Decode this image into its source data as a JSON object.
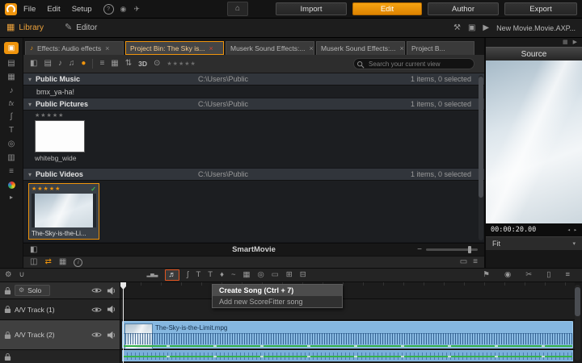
{
  "topbar": {
    "menus": [
      {
        "label": "File"
      },
      {
        "label": "Edit"
      },
      {
        "label": "Setup"
      }
    ],
    "mode_buttons": [
      {
        "label": "Import"
      },
      {
        "label": "Edit"
      },
      {
        "label": "Author"
      },
      {
        "label": "Export"
      }
    ]
  },
  "workspace": {
    "tabs": [
      {
        "label": "Library"
      },
      {
        "label": "Editor"
      }
    ],
    "project_title": "New Movie.Movie.AXP..."
  },
  "bin_tabs": [
    {
      "label": "Effects: Audio effects"
    },
    {
      "label": "Project Bin: The Sky is..."
    },
    {
      "label": "Muserk Sound Effects:..."
    },
    {
      "label": "Muserk Sound Effects:..."
    },
    {
      "label": "Project B..."
    }
  ],
  "lib_toolbar": {
    "threed_label": "3D",
    "stars": "★★★★★",
    "search_placeholder": "Search your current view"
  },
  "library": {
    "groups": [
      {
        "name": "Public Music",
        "path": "C:\\Users\\Public",
        "count": "1 items, 0 selected"
      },
      {
        "name": "Public Pictures",
        "path": "C:\\Users\\Public",
        "count": "1 items, 0 selected"
      },
      {
        "name": "Public Videos",
        "path": "C:\\Users\\Public",
        "count": "1 items, 0 selected"
      }
    ],
    "music_item": "bmx_ya-ha!",
    "picture_item": {
      "label": "whitebg_wide",
      "stars": "★★★★★"
    },
    "video_item": {
      "label": "The-Sky-is-the-Li...",
      "stars": "★★★★★",
      "check": "✓"
    },
    "smartmovie_label": "SmartMovie"
  },
  "tooltip": {
    "title": "Create Song (Ctrl + 7)",
    "subtitle": "Add new ScoreFitter song"
  },
  "source": {
    "title": "Source",
    "timecode": "00:00:20.00",
    "fit_label": "Fit"
  },
  "timeline": {
    "tracks": [
      {
        "label": "Solo"
      },
      {
        "label": "A/V Track (1)"
      },
      {
        "label": "A/V Track (2)"
      }
    ],
    "clip_label": "The-Sky-is-the-Limit.mpg"
  },
  "colors": {
    "accent": "#ef940c",
    "highlight": "#e2541e",
    "clip_blue": "#85b7e0",
    "green_line": "#36b24a"
  },
  "icons": {
    "close": "×",
    "home": "⌂",
    "help": "?",
    "location": "◉",
    "share": "✈",
    "library_grid": "▦",
    "editor_pencil": "✎",
    "wrench": "⚒",
    "panels": "▣",
    "forward": "▶",
    "caret": "▾",
    "fit_caret": "▾",
    "step_back": "◂",
    "step_fwd": "▸",
    "strip": [
      "▣",
      "▤",
      "▦",
      "♪",
      "fx",
      "∫",
      "T",
      "◎",
      "▥",
      "≡",
      "",
      ""
    ],
    "lib_tools": [
      "◧",
      "▤",
      "♪",
      "♫",
      "●",
      "≡",
      "▦",
      "⇅",
      "⊙"
    ],
    "smart_panel": "◧",
    "minus": "−",
    "plus": "+",
    "footer": [
      "◫",
      "⇄",
      "▦"
    ],
    "tl_gear": "⚙",
    "tl_magnet": "∪",
    "tl_cluster": [
      "▂▅▃",
      "♬",
      "∫",
      "T",
      "T",
      "♦",
      "~",
      "▦",
      "◎",
      "▭",
      "⊞",
      "⊟"
    ],
    "tl_right": [
      "⚑",
      "◉",
      "✂",
      "▯",
      "≡"
    ],
    "rp_top": [
      "▦",
      "▶"
    ]
  }
}
